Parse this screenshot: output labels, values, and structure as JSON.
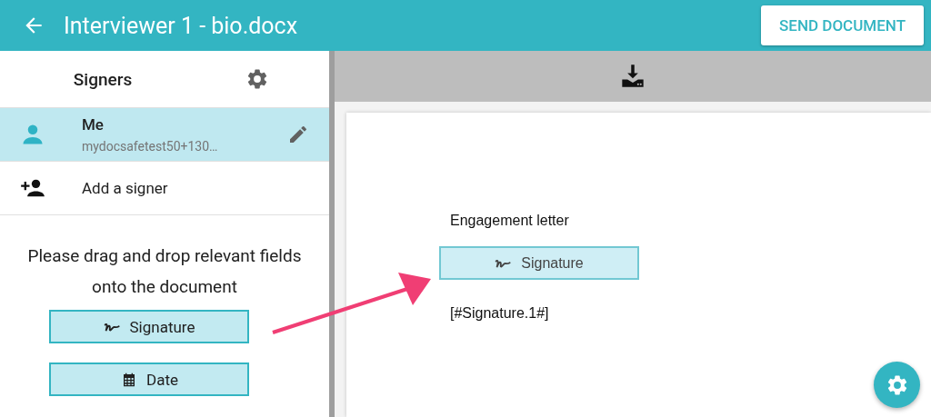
{
  "header": {
    "title": "Interviewer 1 - bio.docx",
    "action": "SEND DOCUMENT"
  },
  "signers_panel": {
    "title": "Signers",
    "items": [
      {
        "kind": "signer",
        "name": "Me",
        "email": "mydocsafetest50+130…",
        "selected": true
      },
      {
        "kind": "add",
        "name": "Add a signer",
        "selected": false
      }
    ],
    "instructions": "Please drag and drop relevant fields onto the document",
    "fields": [
      {
        "kind": "signature",
        "label": "Signature"
      },
      {
        "kind": "date",
        "label": "Date"
      }
    ]
  },
  "document": {
    "lines": [
      {
        "kind": "text",
        "text": "Engagement letter"
      },
      {
        "kind": "signature",
        "text": "Signature"
      },
      {
        "kind": "text",
        "text": "[#Signature.1#]"
      }
    ]
  }
}
